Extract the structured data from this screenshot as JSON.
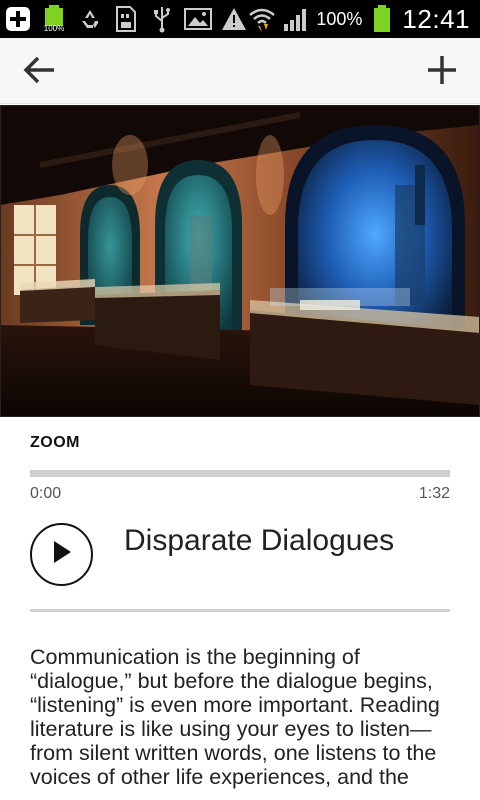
{
  "status_bar": {
    "battery_percent": "100%",
    "time": "12:41",
    "mini_battery_label": "100%",
    "icons": [
      "add-notification-icon",
      "battery-notification-icon",
      "recycle-icon",
      "sd-card-icon",
      "usb-icon",
      "image-icon",
      "warning-icon",
      "wifi-icon",
      "signal-icon",
      "battery-icon"
    ]
  },
  "app_bar": {
    "back_icon": "arrow-left-icon",
    "add_icon": "plus-icon"
  },
  "track": {
    "category": "ZOOM",
    "title": "Disparate Dialogues",
    "time_current": "0:00",
    "time_total": "1:32",
    "progress": 0.0,
    "play_icon": "play-icon"
  },
  "description": "Communication is the beginning of “dialogue,” but before the dialogue begins, “listening” is even more important. Reading literature is like using your eyes to listen—from silent written words, one listens to the voices of other life experiences, and the",
  "colors": {
    "status_bar_bg": "#000000",
    "app_bar_bg": "#f7f7f7",
    "progress_track": "#cfcfcf",
    "divider": "#d0d0d0",
    "battery_green": "#7ed321"
  }
}
